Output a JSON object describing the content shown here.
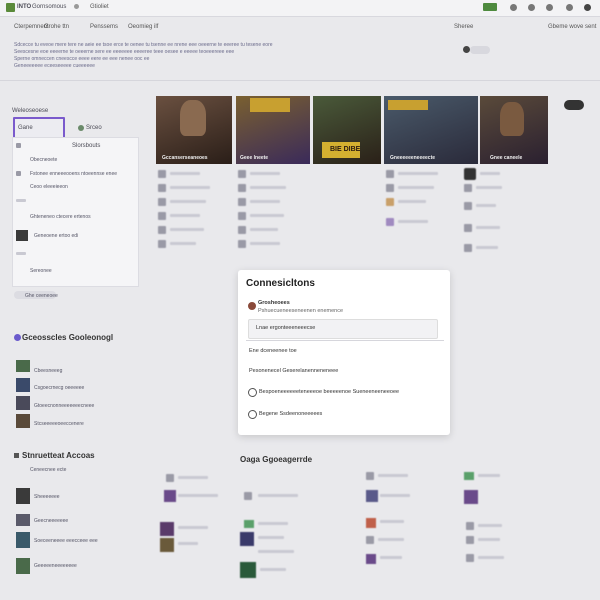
{
  "topbar": {
    "app_name": "INTO",
    "title_suffix": "Gornsomous",
    "nav": [
      "Gtioliet",
      "Cterpemnent",
      "Grohe ttn",
      "Penssems",
      "Oeomieg ilf",
      "Pieresle"
    ],
    "right_labels": [
      "Sheree",
      "Gimsme",
      "Sterriet"
    ],
    "far_right": "Gbeme wove sent"
  },
  "description": {
    "lines": [
      "Sdcecce tu eveoe mere tere ne aeie ee tsoe erce te oenee tu tsenne ee nrene eee oeeerne te eeeree tu tesene eore",
      "Seescesne eoe eeeerne te oeeerne sere ee eeeeeee eeeeree teee oesee e eeeee teoeeereee eee",
      "Sperne omneccen cneescce eeee eere ee eee nenee ooc ee",
      "Geneeeeeee eceeseeeee cueeeeee"
    ],
    "right_note": "Seeqree te enamee e Coreonpay"
  },
  "sidebar": {
    "heading": "Weleoseoese",
    "selected_label": "Gane",
    "alt_label": "Srceo",
    "panel_title": "Slorsbouts",
    "rows": [
      "Obecneoete",
      "Fstonee enneeeooens ntoeennse enee",
      "Ceoo eleeeieeon",
      "",
      "Ghteneneo ctecere ertenos",
      "Geneoene ertoo edi",
      "",
      "Sereonee"
    ],
    "footer_btn": "Ghe ceeneoee"
  },
  "featured": {
    "cards": [
      {
        "caption": "Gccanserseaneoes",
        "color": "#4a3a2a"
      },
      {
        "caption": "Geee lneete",
        "color": "#5a4a2a"
      },
      {
        "caption": "Bre Dibe",
        "color": "#3a3028"
      },
      {
        "caption": "Gneeeeeeneeeecte",
        "color": "#3a4a5a"
      },
      {
        "caption": "Gnee caneele",
        "color": "#4a3a30"
      }
    ],
    "banner_text": "BIE DIBE"
  },
  "modal": {
    "title": "Connesicltons",
    "app_label": "Grosheoees",
    "app_sub": "Pshuecueneeseneenen enemence",
    "input_value": "Lnae ergonteeeneeecse",
    "line1": "Ene dceneenee toe",
    "line2": "Pesonenecel Geserelanenneneneee",
    "line3": "Bespoeneeeeeeteneeeoe beeeeenoe Sueneeneeneeoee",
    "line4": "Begene Ssdeenoneeeees"
  },
  "sections": {
    "left_header": "Gceosscles Gooleonogl",
    "left_items": [
      "Cbeesneeeg",
      "Csgoecrnecg oeeeeee",
      "Gtoeecnonneeeeeeecneee",
      "Stcseeeeeoeeccenere"
    ],
    "bottom_left_header": "Stnruetteat Accoas",
    "bottom_left_sub": "Ceneecnee ecte",
    "bottom_items": [
      "Sheeeeeee",
      "Geecneeeeeee",
      "Soeceeneeee eeecceee eee",
      "Geeeeeneeeeeeee"
    ],
    "bottom_mid_header": "Oaga Ggoeagerrde"
  }
}
